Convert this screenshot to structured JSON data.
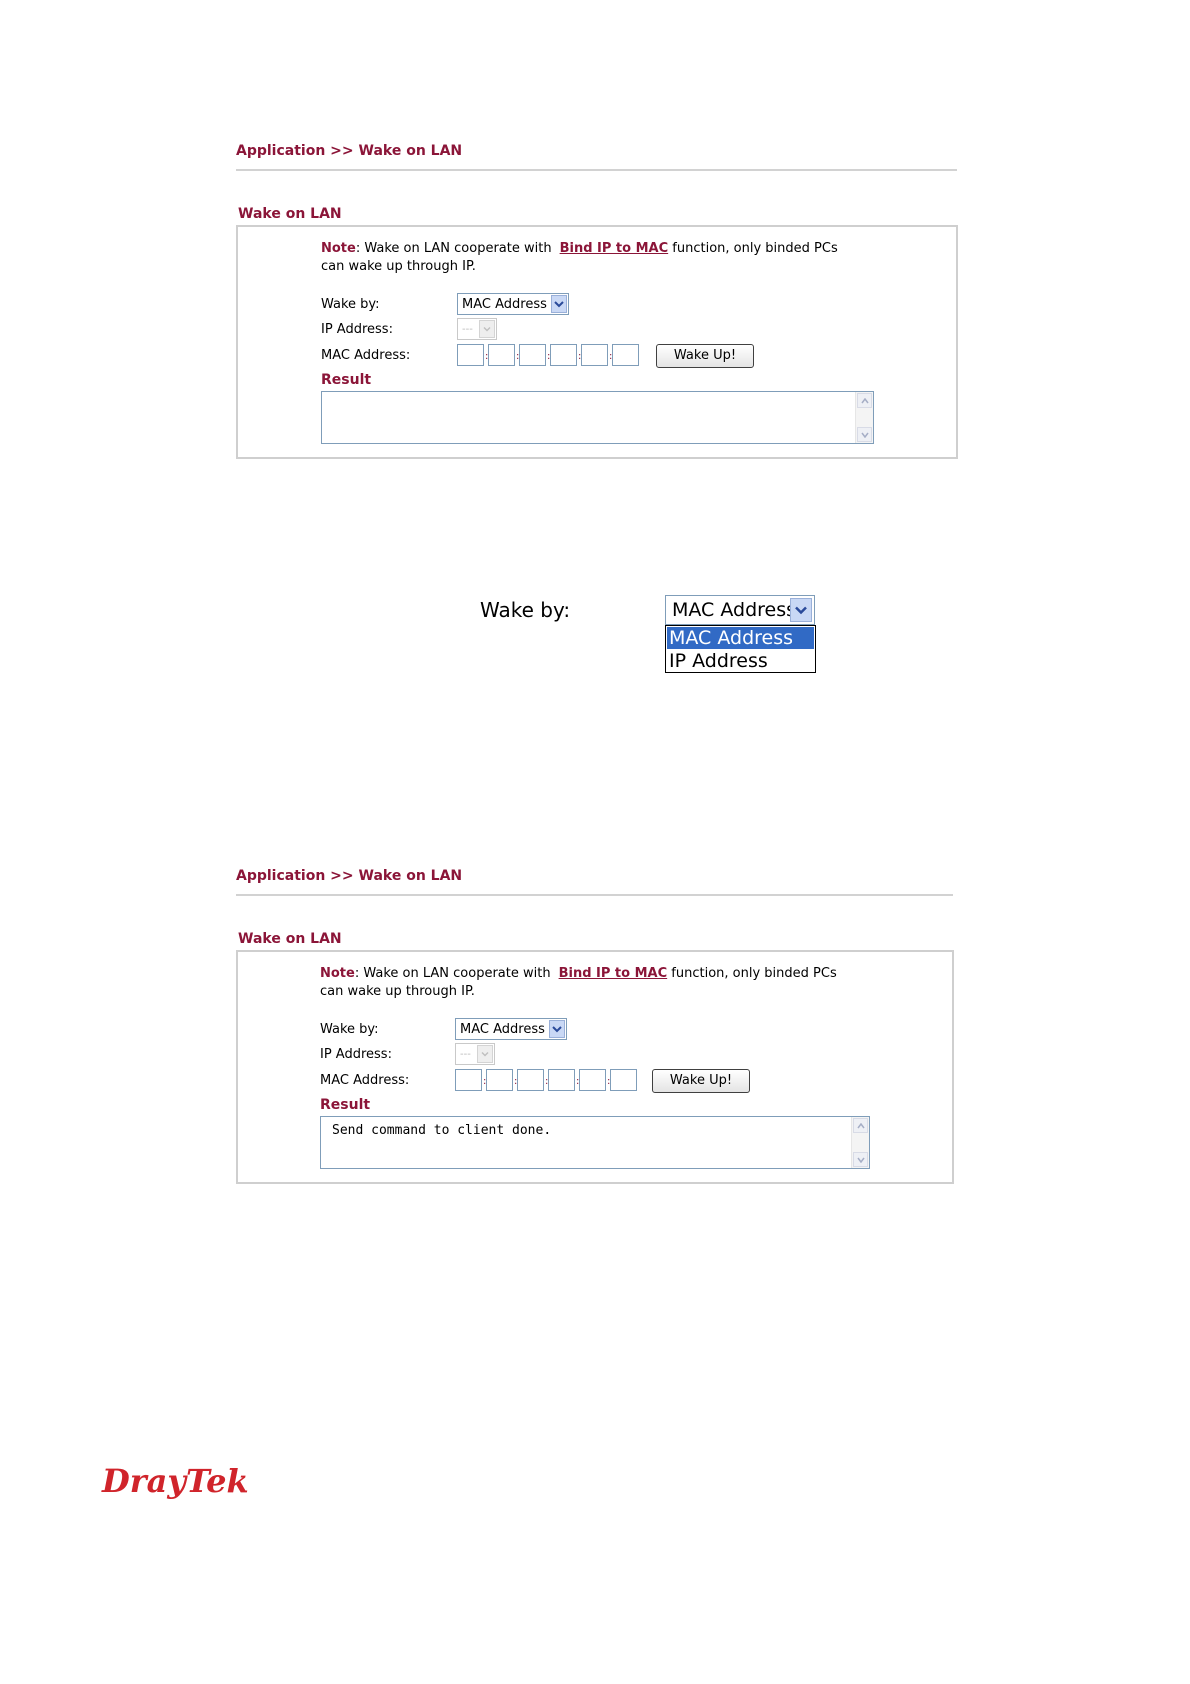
{
  "panel1": {
    "breadcrumb": "Application >> Wake on LAN",
    "section_title": "Wake on LAN",
    "note": {
      "label": "Note",
      "text_before_link": ": Wake on LAN cooperate with",
      "link_text": "Bind IP to MAC",
      "text_after_link": "function,  only binded PCs",
      "line2": "can wake up through IP."
    },
    "wake_by_label": "Wake by:",
    "wake_by_value": "MAC Address",
    "ip_address_label": "IP Address:",
    "ip_address_value": "---",
    "mac_address_label": "MAC Address:",
    "wake_button": "Wake Up!",
    "result_label": "Result",
    "result_text": ""
  },
  "dropdown_zoom": {
    "label": "Wake by:",
    "selected": "MAC Address",
    "options": [
      "MAC Address",
      "IP Address"
    ]
  },
  "panel2": {
    "breadcrumb": "Application >> Wake on LAN",
    "section_title": "Wake on LAN",
    "note": {
      "label": "Note",
      "text_before_link": ": Wake on LAN cooperate with",
      "link_text": "Bind IP to MAC",
      "text_after_link": "function,  only binded PCs",
      "line2": "can wake up through IP."
    },
    "wake_by_label": "Wake by:",
    "wake_by_value": "MAC Address",
    "ip_address_label": "IP Address:",
    "ip_address_value": "---",
    "mac_address_label": "MAC Address:",
    "wake_button": "Wake Up!",
    "result_label": "Result",
    "result_text": "Send command to client done."
  },
  "footer": {
    "logo": "DrayTek"
  },
  "colors": {
    "accent": "#8b1538",
    "logo": "#d0242b",
    "selection": "#316ac5"
  },
  "icons": {
    "dropdown": "chevron-down-icon",
    "scroll_up": "scroll-up-arrow-icon",
    "scroll_down": "scroll-down-arrow-icon"
  }
}
